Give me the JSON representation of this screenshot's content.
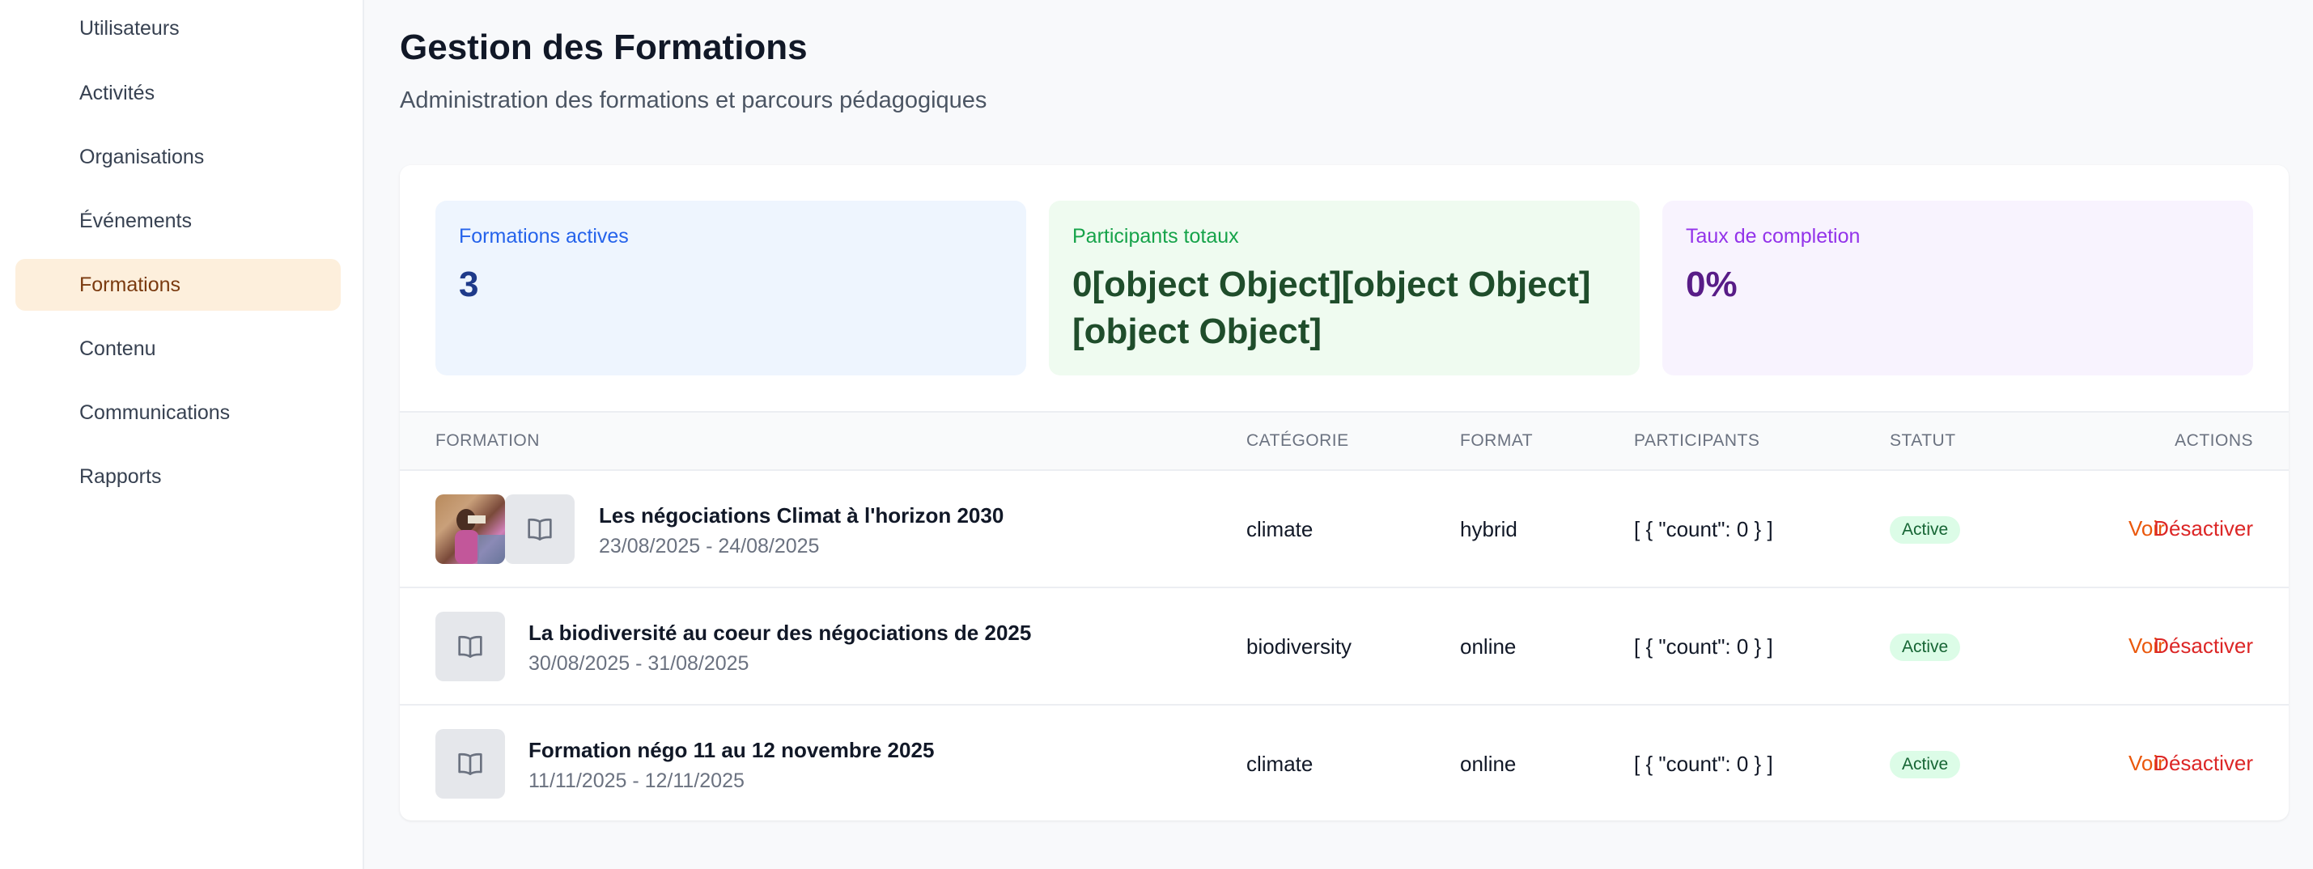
{
  "sidebar": {
    "items": [
      {
        "label": "Utilisateurs"
      },
      {
        "label": "Activités"
      },
      {
        "label": "Organisations"
      },
      {
        "label": "Événements"
      },
      {
        "label": "Formations"
      },
      {
        "label": "Contenu"
      },
      {
        "label": "Communications"
      },
      {
        "label": "Rapports"
      }
    ],
    "active_label": "Formations"
  },
  "header": {
    "title": "Gestion des Formations",
    "subtitle": "Administration des formations et parcours pédagogiques"
  },
  "stats": [
    {
      "label": "Formations actives",
      "value": "3"
    },
    {
      "label": "Participants totaux",
      "value": "0[object Object][object Object][object Object]"
    },
    {
      "label": "Taux de completion",
      "value": "0%"
    }
  ],
  "table": {
    "columns": [
      "FORMATION",
      "CATÉGORIE",
      "FORMAT",
      "PARTICIPANTS",
      "STATUT",
      "ACTIONS"
    ],
    "rows": [
      {
        "title": "Les négociations Climat à l'horizon 2030",
        "dates": "23/08/2025 - 24/08/2025",
        "category": "climate",
        "format": "hybrid",
        "participants": "[ { \"count\": 0 } ]",
        "status": "Active",
        "view": "Voir",
        "deactivate": "Désactiver"
      },
      {
        "title": "La biodiversité au coeur des négociations de 2025",
        "dates": "30/08/2025 - 31/08/2025",
        "category": "biodiversity",
        "format": "online",
        "participants": "[ { \"count\": 0 } ]",
        "status": "Active",
        "view": "Voir",
        "deactivate": "Désactiver"
      },
      {
        "title": "Formation négo 11 au 12 novembre 2025",
        "dates": "11/11/2025 - 12/11/2025",
        "category": "climate",
        "format": "online",
        "participants": "[ { \"count\": 0 } ]",
        "status": "Active",
        "view": "Voir",
        "deactivate": "Désactiver"
      }
    ]
  },
  "icons": {
    "thumbnail_placeholder": "book-open-icon"
  },
  "colors": {
    "accent": "#fdefdc",
    "view_action": "#ea580c",
    "deactivate_action": "#dc2626",
    "status_active": "#dcfce7"
  }
}
